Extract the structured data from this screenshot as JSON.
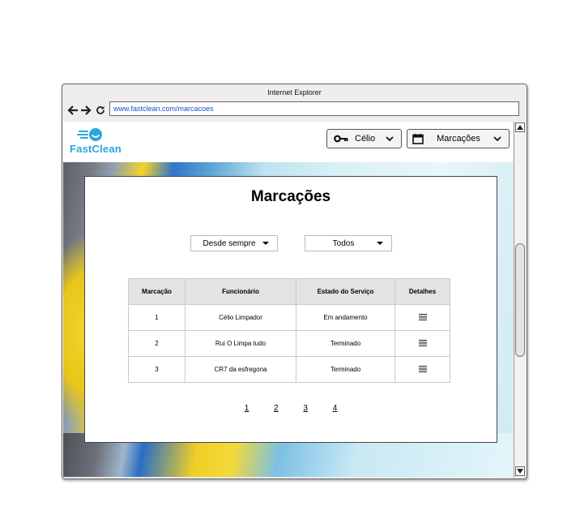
{
  "browser": {
    "title": "Internet Explorer",
    "url": "www.fastclean.com/marcacoes",
    "icons": [
      "back-arrow-icon",
      "forward-arrow-icon",
      "reload-icon"
    ]
  },
  "header": {
    "logo_text": "FastClean",
    "user_button": {
      "label": "Célio",
      "icon": "key-icon"
    },
    "section_button": {
      "label": "Marcações",
      "icon": "calendar-icon"
    }
  },
  "main": {
    "title": "Marcações",
    "filters": [
      {
        "name": "period-filter",
        "value": "Desde sempre"
      },
      {
        "name": "state-filter",
        "value": "Todos"
      }
    ],
    "table": {
      "columns": [
        "Marcação",
        "Funcionário",
        "Estado do Serviço",
        "Detalhes"
      ],
      "rows": [
        {
          "id": "1",
          "employee": "Célio Limpador",
          "state": "Em andamento"
        },
        {
          "id": "2",
          "employee": "Rui O Limpa tudo",
          "state": "Terminado"
        },
        {
          "id": "3",
          "employee": "CR7 da esfregona",
          "state": "Terminado"
        }
      ]
    },
    "pagination": [
      "1",
      "2",
      "3",
      "4"
    ]
  },
  "colors": {
    "brand": "#2aa7dc",
    "url_text": "#1a4fd0",
    "table_header_bg": "#e3e3e3"
  }
}
